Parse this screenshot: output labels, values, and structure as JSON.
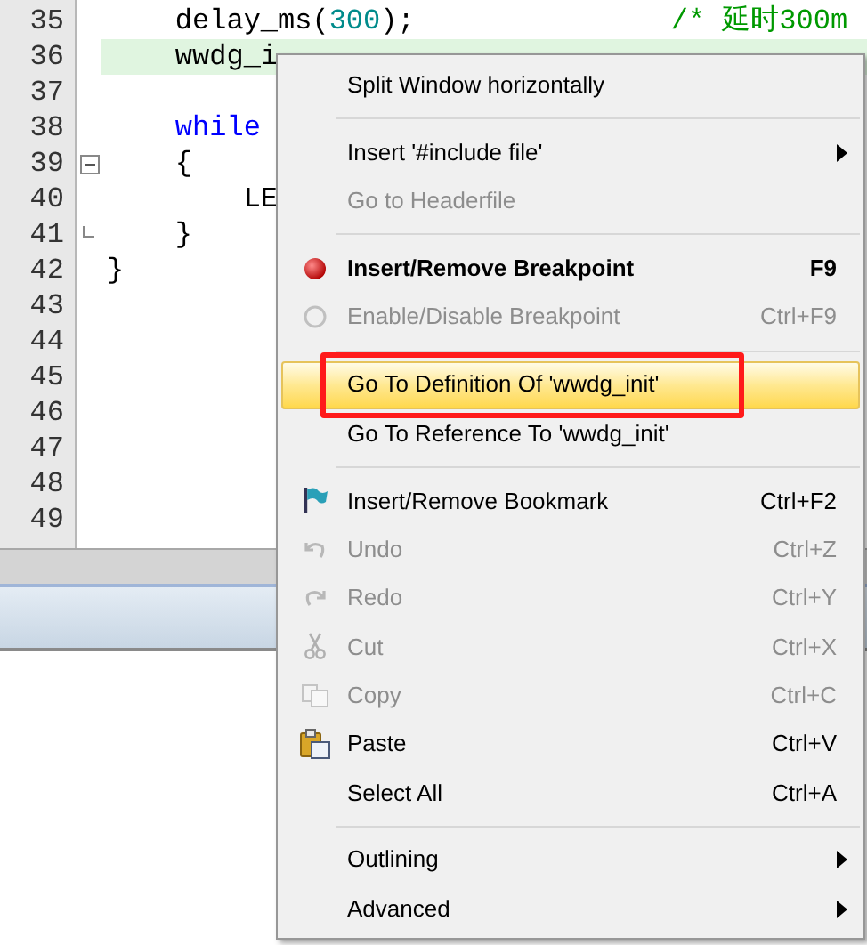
{
  "editor": {
    "lines": [
      {
        "number": "35",
        "highlighted": false,
        "segments": [
          {
            "kind": "plain",
            "text": "    delay_ms("
          },
          {
            "kind": "number",
            "text": "300"
          },
          {
            "kind": "plain",
            "text": ");               "
          },
          {
            "kind": "comment",
            "text": "/* 延时300m"
          }
        ]
      },
      {
        "number": "36",
        "highlighted": true,
        "segments": [
          {
            "kind": "plain",
            "text": "    wwdg_i"
          }
        ]
      },
      {
        "number": "37",
        "highlighted": false
      },
      {
        "number": "38",
        "highlighted": false,
        "segments": [
          {
            "kind": "keyword",
            "text": "    while"
          }
        ]
      },
      {
        "number": "39",
        "highlighted": false,
        "fold_start": true,
        "segments": [
          {
            "kind": "plain",
            "text": "    {"
          }
        ]
      },
      {
        "number": "40",
        "highlighted": false,
        "segments": [
          {
            "kind": "plain",
            "text": "        LE"
          }
        ]
      },
      {
        "number": "41",
        "highlighted": false,
        "fold_end": true,
        "segments": [
          {
            "kind": "plain",
            "text": "    }"
          }
        ]
      },
      {
        "number": "42",
        "highlighted": false,
        "segments": [
          {
            "kind": "plain",
            "text": "}"
          }
        ]
      },
      {
        "number": "43",
        "highlighted": false
      },
      {
        "number": "44",
        "highlighted": false
      },
      {
        "number": "45",
        "highlighted": false
      },
      {
        "number": "46",
        "highlighted": false
      },
      {
        "number": "47",
        "highlighted": false
      },
      {
        "number": "48",
        "highlighted": false
      },
      {
        "number": "49",
        "highlighted": false
      }
    ]
  },
  "context_menu": {
    "items": [
      {
        "kind": "item",
        "label": "Split Window horizontally",
        "disabled": false,
        "default": false,
        "selected": false,
        "submenu": false
      },
      {
        "kind": "separator"
      },
      {
        "kind": "item",
        "label": "Insert '#include file'",
        "disabled": false,
        "default": false,
        "selected": false,
        "submenu": true
      },
      {
        "kind": "item",
        "label": "Go to Headerfile",
        "disabled": true,
        "default": false,
        "selected": false,
        "submenu": false
      },
      {
        "kind": "separator"
      },
      {
        "kind": "item",
        "label": "Insert/Remove Breakpoint",
        "shortcut": "F9",
        "disabled": false,
        "default": true,
        "selected": false,
        "submenu": false
      },
      {
        "kind": "item",
        "label": "Enable/Disable Breakpoint",
        "shortcut": "Ctrl+F9",
        "disabled": true,
        "default": false,
        "selected": false,
        "submenu": false
      },
      {
        "kind": "separator"
      },
      {
        "kind": "item",
        "label": "Go To Definition Of 'wwdg_init'",
        "disabled": false,
        "default": false,
        "selected": true,
        "submenu": false
      },
      {
        "kind": "item",
        "label": "Go To Reference To 'wwdg_init'",
        "disabled": false,
        "default": false,
        "selected": false,
        "submenu": false
      },
      {
        "kind": "separator"
      },
      {
        "kind": "item",
        "label": "Insert/Remove Bookmark",
        "shortcut": "Ctrl+F2",
        "disabled": false,
        "default": false,
        "selected": false,
        "submenu": false
      },
      {
        "kind": "item",
        "label": "Undo",
        "shortcut": "Ctrl+Z",
        "disabled": true,
        "default": false,
        "selected": false,
        "submenu": false
      },
      {
        "kind": "item",
        "label": "Redo",
        "shortcut": "Ctrl+Y",
        "disabled": true,
        "default": false,
        "selected": false,
        "submenu": false
      },
      {
        "kind": "item",
        "label": "Cut",
        "shortcut": "Ctrl+X",
        "disabled": true,
        "default": false,
        "selected": false,
        "submenu": false
      },
      {
        "kind": "item",
        "label": "Copy",
        "shortcut": "Ctrl+C",
        "disabled": true,
        "default": false,
        "selected": false,
        "submenu": false
      },
      {
        "kind": "item",
        "label": "Paste",
        "shortcut": "Ctrl+V",
        "disabled": false,
        "default": false,
        "selected": false,
        "submenu": false
      },
      {
        "kind": "item",
        "label": "Select All",
        "shortcut": "Ctrl+A",
        "disabled": false,
        "default": false,
        "selected": false,
        "submenu": false
      },
      {
        "kind": "separator"
      },
      {
        "kind": "item",
        "label": "Outlining",
        "disabled": false,
        "default": false,
        "selected": false,
        "submenu": true
      },
      {
        "kind": "item",
        "label": "Advanced",
        "disabled": false,
        "default": false,
        "selected": false,
        "submenu": true
      }
    ]
  }
}
